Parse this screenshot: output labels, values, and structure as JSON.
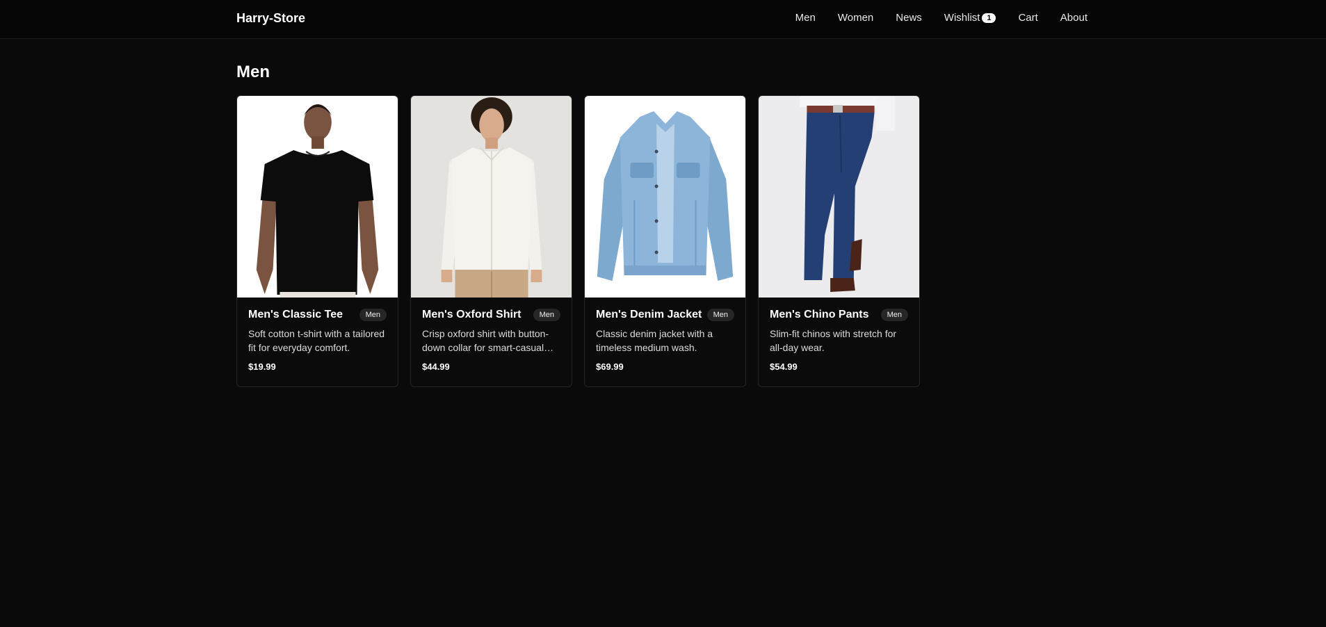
{
  "header": {
    "brand": "Harry-Store",
    "nav": [
      {
        "label": "Men"
      },
      {
        "label": "Women"
      },
      {
        "label": "News"
      },
      {
        "label": "Wishlist",
        "count": "1"
      },
      {
        "label": "Cart"
      },
      {
        "label": "About"
      }
    ]
  },
  "main": {
    "title": "Men",
    "products": [
      {
        "name": "Men's Classic Tee",
        "tag": "Men",
        "description": "Soft cotton t-shirt with a tailored fit for everyday comfort.",
        "price": "$19.99",
        "image": "black-tshirt-photo"
      },
      {
        "name": "Men's Oxford Shirt",
        "tag": "Men",
        "description": "Crisp oxford shirt with button-down collar for smart-casual looks.",
        "price": "$44.99",
        "image": "white-oxford-shirt-photo"
      },
      {
        "name": "Men's Denim Jacket",
        "tag": "Men",
        "description": "Classic denim jacket with a timeless medium wash.",
        "price": "$69.99",
        "image": "denim-jacket-photo"
      },
      {
        "name": "Men's Chino Pants",
        "tag": "Men",
        "description": "Slim-fit chinos with stretch for all-day wear.",
        "price": "$54.99",
        "image": "navy-chinos-photo"
      }
    ]
  }
}
